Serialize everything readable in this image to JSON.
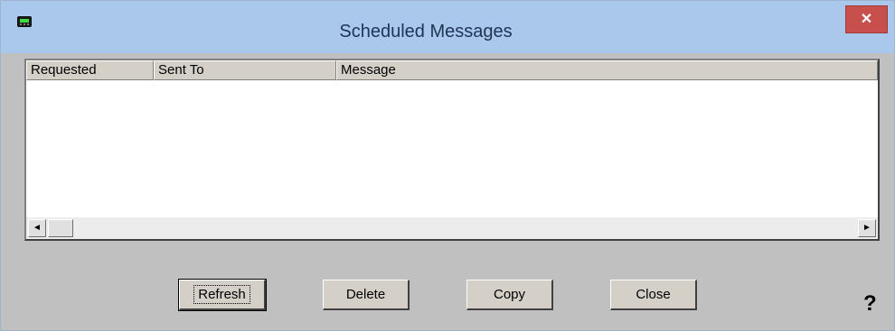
{
  "window": {
    "title": "Scheduled Messages",
    "close_glyph": "✕",
    "app_icon": "pager-icon"
  },
  "list": {
    "columns": [
      "Requested",
      "Sent To",
      "Message"
    ],
    "rows": [],
    "scroll_left_glyph": "◄",
    "scroll_right_glyph": "►"
  },
  "buttons": {
    "refresh": "Refresh",
    "delete": "Delete",
    "copy": "Copy",
    "close": "Close"
  },
  "help": {
    "glyph": "?"
  }
}
